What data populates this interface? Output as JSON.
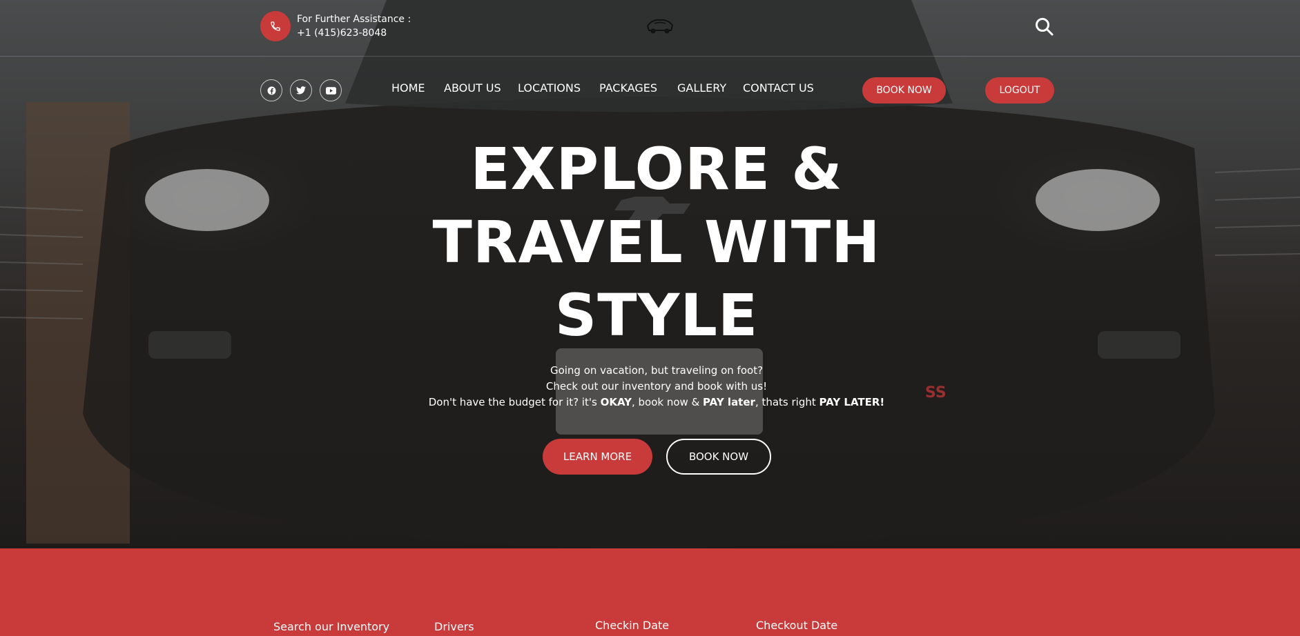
{
  "topbar": {
    "assist_label": "For Further Assistance :",
    "phone": "+1 (415)623-8048"
  },
  "social": [
    "facebook-icon",
    "twitter-icon",
    "youtube-icon"
  ],
  "nav": {
    "items": [
      "HOME",
      "ABOUT US",
      "LOCATIONS",
      "PACKAGES",
      "GALLERY",
      "CONTACT US"
    ],
    "book_now": "BOOK NOW",
    "logout": "LOGOUT"
  },
  "hero": {
    "headline": [
      "EXPLORE &",
      "TRAVEL WITH",
      "STYLE"
    ],
    "line1": "Going on vacation, but traveling on foot?",
    "line2": "Check out our inventory and book with us!",
    "line3_a": "Don't have the budget for it? it's ",
    "line3_b": "OKAY",
    "line3_c": ", book now & ",
    "line3_d": "PAY later",
    "line3_e": ", thats right ",
    "line3_f": "PAY LATER!",
    "learn_more": "LEARN MORE",
    "book_now": "BOOK NOW"
  },
  "booking": {
    "labels": [
      "Search our Inventory",
      "Drivers",
      "Checkin Date",
      "Checkout Date"
    ]
  },
  "colors": {
    "accent": "#c93a3a",
    "overlay": "#3b3b3b"
  }
}
